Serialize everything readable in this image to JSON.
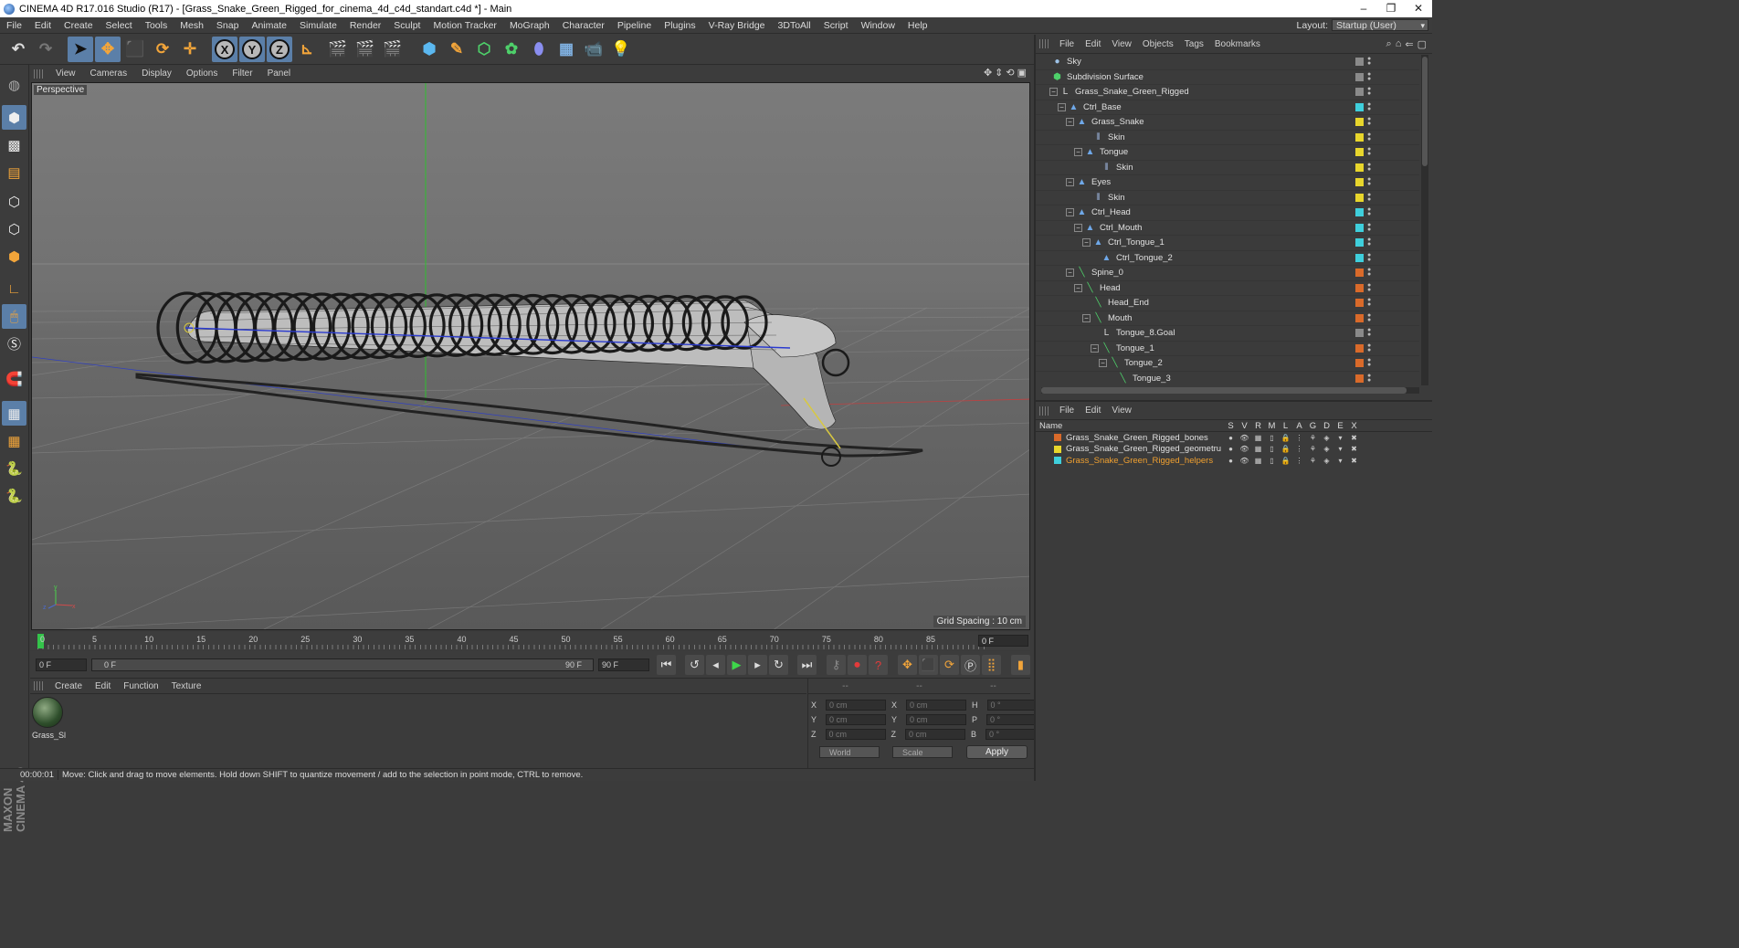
{
  "window": {
    "title": "CINEMA 4D R17.016 Studio (R17) - [Grass_Snake_Green_Rigged_for_cinema_4d_c4d_standart.c4d *] - Main",
    "controls": [
      "–",
      "❐",
      "✕"
    ]
  },
  "menubar": {
    "items": [
      "File",
      "Edit",
      "Create",
      "Select",
      "Tools",
      "Mesh",
      "Snap",
      "Animate",
      "Simulate",
      "Render",
      "Sculpt",
      "Motion Tracker",
      "MoGraph",
      "Character",
      "Pipeline",
      "Plugins",
      "V-Ray Bridge",
      "3DToAll",
      "Script",
      "Window",
      "Help"
    ],
    "layout_label": "Layout:",
    "layout_value": "Startup (User)"
  },
  "toolbar": {
    "undo": "↶",
    "redo": "↷",
    "axis_x": "X",
    "axis_y": "Y",
    "axis_z": "Z"
  },
  "viewport": {
    "menu": [
      "View",
      "Cameras",
      "Display",
      "Options",
      "Filter",
      "Panel"
    ],
    "label": "Perspective",
    "grid_spacing": "Grid Spacing : 10 cm",
    "axis_x": "x",
    "axis_y": "y",
    "axis_z": "z"
  },
  "timeline": {
    "ticks": [
      "0",
      "5",
      "10",
      "15",
      "20",
      "25",
      "30",
      "35",
      "40",
      "45",
      "50",
      "55",
      "60",
      "65",
      "70",
      "75",
      "80",
      "85",
      "90"
    ],
    "current_frame": "0 F",
    "start_frame": "0 F",
    "range_start": "0 F",
    "range_end": "90 F",
    "end_frame": "90 F"
  },
  "material_manager": {
    "menu": [
      "Create",
      "Edit",
      "Function",
      "Texture"
    ],
    "materials": [
      {
        "name": "Grass_Sl"
      }
    ]
  },
  "coordinates": {
    "headers": [
      "--",
      "--",
      "--"
    ],
    "rows": [
      {
        "a": "X",
        "av": "0 cm",
        "b": "X",
        "bv": "0 cm",
        "c": "H",
        "cv": "0 °"
      },
      {
        "a": "Y",
        "av": "0 cm",
        "b": "Y",
        "bv": "0 cm",
        "c": "P",
        "cv": "0 °"
      },
      {
        "a": "Z",
        "av": "0 cm",
        "b": "Z",
        "bv": "0 cm",
        "c": "B",
        "cv": "0 °"
      }
    ],
    "mode": "World",
    "transform": "Scale",
    "apply": "Apply"
  },
  "status": {
    "time": "00:00:01",
    "message": "Move: Click and drag to move elements. Hold down SHIFT to quantize movement / add to the selection in point mode, CTRL to remove."
  },
  "object_manager": {
    "menu": [
      "File",
      "Edit",
      "View",
      "Objects",
      "Tags",
      "Bookmarks"
    ],
    "objects": [
      {
        "name": "Sky",
        "depth": 0,
        "color": "#8a8a8a"
      },
      {
        "name": "Subdivision Surface",
        "depth": 0,
        "color": "#8a8a8a"
      },
      {
        "name": "Grass_Snake_Green_Rigged",
        "depth": 1,
        "color": "#8a8a8a"
      },
      {
        "name": "Ctrl_Base",
        "depth": 2,
        "color": "#3fcfdc"
      },
      {
        "name": "Grass_Snake",
        "depth": 3,
        "color": "#e8d62c"
      },
      {
        "name": "Skin",
        "depth": 5,
        "color": "#e8d62c"
      },
      {
        "name": "Tongue",
        "depth": 4,
        "color": "#e8d62c"
      },
      {
        "name": "Skin",
        "depth": 6,
        "color": "#e8d62c"
      },
      {
        "name": "Eyes",
        "depth": 3,
        "color": "#e8d62c"
      },
      {
        "name": "Skin",
        "depth": 5,
        "color": "#e8d62c"
      },
      {
        "name": "Ctrl_Head",
        "depth": 3,
        "color": "#3fcfdc"
      },
      {
        "name": "Ctrl_Mouth",
        "depth": 4,
        "color": "#3fcfdc"
      },
      {
        "name": "Ctrl_Tongue_1",
        "depth": 5,
        "color": "#3fcfdc"
      },
      {
        "name": "Ctrl_Tongue_2",
        "depth": 6,
        "color": "#3fcfdc"
      },
      {
        "name": "Spine_0",
        "depth": 3,
        "color": "#d96a2a"
      },
      {
        "name": "Head",
        "depth": 4,
        "color": "#d96a2a"
      },
      {
        "name": "Head_End",
        "depth": 5,
        "color": "#d96a2a"
      },
      {
        "name": "Mouth",
        "depth": 5,
        "color": "#d96a2a"
      },
      {
        "name": "Tongue_8.Goal",
        "depth": 6,
        "color": "#8a8a8a"
      },
      {
        "name": "Tongue_1",
        "depth": 6,
        "color": "#d96a2a"
      },
      {
        "name": "Tongue_2",
        "depth": 7,
        "color": "#d96a2a"
      },
      {
        "name": "Tongue_3",
        "depth": 8,
        "color": "#d96a2a"
      }
    ]
  },
  "layer_manager": {
    "menu": [
      "File",
      "Edit",
      "View"
    ],
    "name_header": "Name",
    "columns": [
      "S",
      "V",
      "R",
      "M",
      "L",
      "A",
      "G",
      "D",
      "E",
      "X"
    ],
    "layers": [
      {
        "name": "Grass_Snake_Green_Rigged_bones",
        "color": "#d96a2a"
      },
      {
        "name": "Grass_Snake_Green_Rigged_geometru",
        "color": "#e8d62c"
      },
      {
        "name": "Grass_Snake_Green_Rigged_helpers",
        "color": "#3fcfdc"
      }
    ]
  },
  "colors": {
    "accent": "#5b7fa8",
    "active_layer_text": "#f0a030",
    "playhead": "#34c34a"
  }
}
